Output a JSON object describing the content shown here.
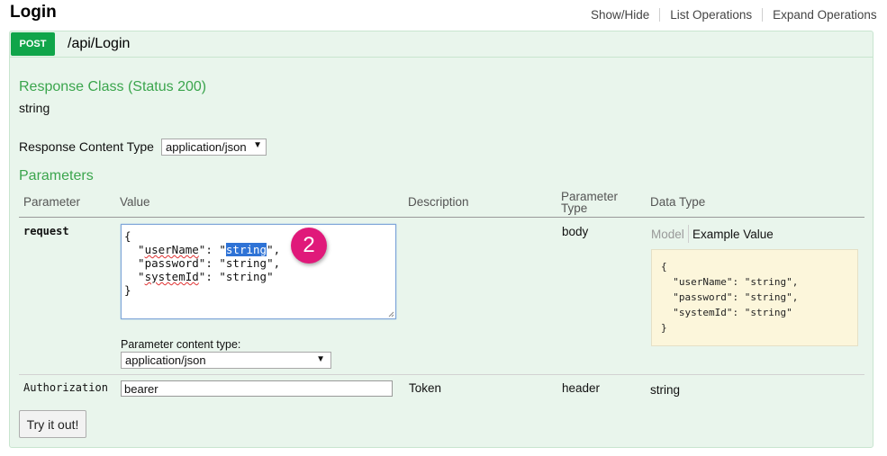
{
  "page_title": "Login",
  "header_links": [
    "Show/Hide",
    "List Operations",
    "Expand Operations"
  ],
  "operation": {
    "method": "POST",
    "path": "/api/Login",
    "response_class_label": "Response Class (Status 200)",
    "response_type": "string",
    "response_content_type_label": "Response Content Type",
    "response_content_type_value": "application/json",
    "parameters_heading": "Parameters",
    "columns": {
      "parameter": "Parameter",
      "value": "Value",
      "description": "Description",
      "parameter_type_1": "Parameter",
      "parameter_type_2": "Type",
      "data_type": "Data Type"
    },
    "request_row": {
      "name": "request",
      "body_open": "{",
      "key_username": "userName",
      "key_password": "password",
      "key_systemid": "systemId",
      "string_value": "string",
      "body_close": "}",
      "param_type": "body",
      "model_tab": "Model",
      "example_tab": "Example Value",
      "example_json": "{\n  \"userName\": \"string\",\n  \"password\": \"string\",\n  \"systemId\": \"string\"\n}",
      "content_type_label": "Parameter content type:",
      "content_type_value": "application/json"
    },
    "auth_row": {
      "name": "Authorization",
      "value": "bearer",
      "description": "Token",
      "param_type": "header",
      "data_type": "string"
    },
    "try_button": "Try it out!"
  },
  "annotation_badge": "2",
  "colors": {
    "method_post": "#10a54a",
    "section_heading": "#3ba54d",
    "panel_background": "#e9f5ec",
    "example_background": "#fcf6db",
    "badge": "#e0197a",
    "selection": "#2f73d6"
  }
}
